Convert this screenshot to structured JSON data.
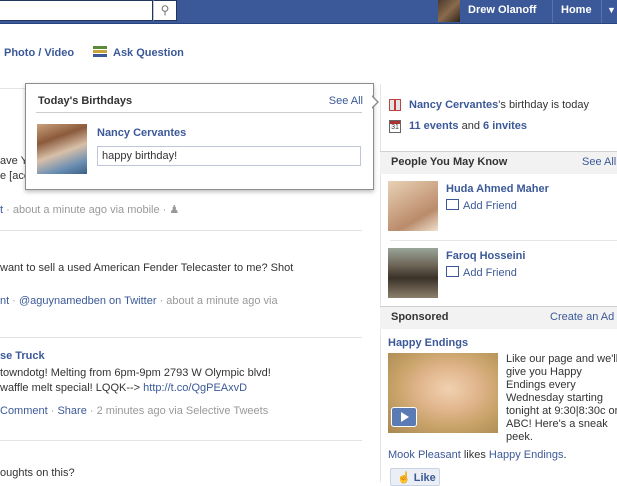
{
  "topbar": {
    "user_name": "Drew Olanoff",
    "home_label": "Home",
    "search_icon": "magnifier-icon",
    "menu_icon": "caret-down-icon"
  },
  "composer": {
    "photo_video": "Photo / Video",
    "ask_question": "Ask Question"
  },
  "birthday_popup": {
    "title": "Today's Birthdays",
    "see_all": "See All",
    "person_name": "Nancy Cervantes",
    "message_value": "happy birthday!"
  },
  "feed": {
    "post1": {
      "line1": "ave Y",
      "line2": "e [acc",
      "meta_link": "t",
      "meta_text": " · about a minute ago via mobile · "
    },
    "post2": {
      "text": " want to sell a used American Fender Telecaster to me? Shot",
      "meta_link1": "nt",
      "meta_sep1": " · ",
      "meta_link2": "@aguynamedben on Twitter",
      "meta_text": " · about a minute ago via"
    },
    "post3": {
      "name": "se Truck",
      "line1": "towndotg! Melting from 6pm-9pm 2793 W Olympic blvd!",
      "line2_text": " waffle melt special! LQQK--> ",
      "line2_link": "http://t.co/QgPEAxvD",
      "meta_link1": "Comment",
      "meta_sep1": " · ",
      "meta_link2": "Share",
      "meta_text": " · 2 minutes ago via Selective Tweets"
    },
    "post4": {
      "text": "oughts on this?"
    }
  },
  "sidebar": {
    "birthday": {
      "name": "Nancy Cervantes",
      "suffix": "'s birthday is today"
    },
    "events": {
      "count_label": "11 events",
      "and": " and ",
      "invites_label": "6 invites",
      "calendar_day": "31"
    },
    "pymk": {
      "title": "People You May Know",
      "see_all": "See All",
      "people": [
        {
          "name": "Huda Ahmed Maher",
          "action": "Add Friend"
        },
        {
          "name": "Faroq Hosseini",
          "action": "Add Friend"
        }
      ]
    },
    "sponsored": {
      "title": "Sponsored",
      "create_ad": "Create an Ad",
      "ad_title": "Happy Endings",
      "ad_body": "Like our page and we'll give you Happy Endings every Wednesday starting tonight at 9:30|8:30c on ABC! Here's a sneak peek.",
      "social_name": "Mook Pleasant",
      "social_likes": " likes ",
      "social_page": "Happy Endings",
      "social_end": ".",
      "like_button": "Like"
    }
  }
}
